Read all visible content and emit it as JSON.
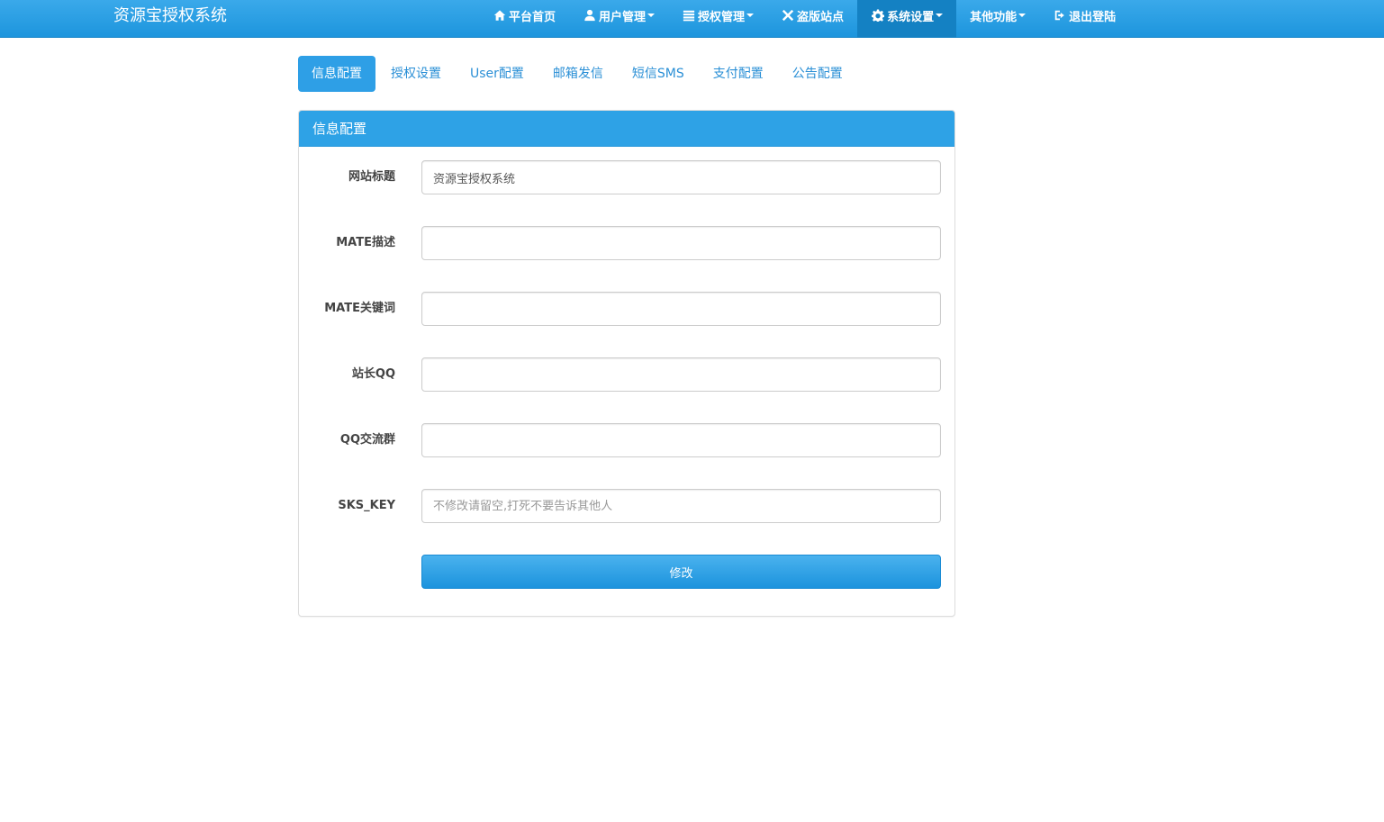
{
  "brand": {
    "title": "资源宝授权系统"
  },
  "nav": {
    "items": [
      {
        "label": "平台首页",
        "icon": "home-icon",
        "dropdown": false
      },
      {
        "label": "用户管理",
        "icon": "user-icon",
        "dropdown": true
      },
      {
        "label": "授权管理",
        "icon": "list-icon",
        "dropdown": true
      },
      {
        "label": "盗版站点",
        "icon": "close-icon",
        "dropdown": false
      },
      {
        "label": "系统设置",
        "icon": "gear-icon",
        "dropdown": true,
        "active": true
      },
      {
        "label": "其他功能",
        "icon": "",
        "dropdown": true
      },
      {
        "label": "退出登陆",
        "icon": "logout-icon",
        "dropdown": false
      }
    ]
  },
  "tabs": [
    {
      "label": "信息配置",
      "active": true
    },
    {
      "label": "授权设置"
    },
    {
      "label": "User配置"
    },
    {
      "label": "邮箱发信"
    },
    {
      "label": "短信SMS"
    },
    {
      "label": "支付配置"
    },
    {
      "label": "公告配置"
    }
  ],
  "panel": {
    "title": "信息配置",
    "fields": [
      {
        "label": "网站标题",
        "value": "资源宝授权系统",
        "placeholder": ""
      },
      {
        "label": "MATE描述",
        "value": "",
        "placeholder": ""
      },
      {
        "label": "MATE关键词",
        "value": "",
        "placeholder": ""
      },
      {
        "label": "站长QQ",
        "value": "",
        "placeholder": ""
      },
      {
        "label": "QQ交流群",
        "value": "",
        "placeholder": ""
      },
      {
        "label": "SKS_KEY",
        "value": "",
        "placeholder": "不修改请留空,打死不要告诉其他人"
      }
    ],
    "submit_label": "修改"
  },
  "colors": {
    "navbar": "#2a9fe4",
    "nav_active": "#1481c3",
    "tab_active": "#2e9fe6",
    "link": "#2a8fd6",
    "panel_heading": "#2ea2e6"
  }
}
